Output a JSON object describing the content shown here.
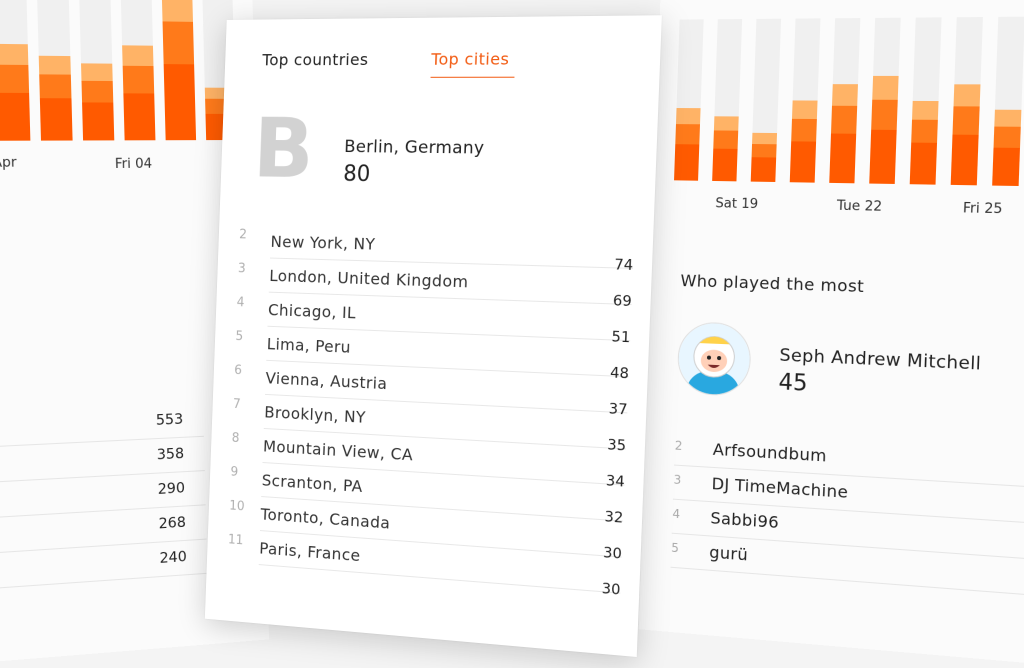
{
  "colors": {
    "accent": "#f25b12",
    "bar_track": "#f0f0f0",
    "bar_dark": "#ff5a00",
    "bar_mid": "#ff7a1a",
    "bar_light": "#ffb366"
  },
  "left_chart": {
    "labels": [
      "Apr",
      "Fri 04"
    ],
    "bars": [
      0.55,
      0.62,
      0.55,
      0.5,
      0.62,
      1.0,
      0.35
    ]
  },
  "left_values": [
    "553",
    "358",
    "290",
    "268",
    "240"
  ],
  "tabs": {
    "countries": "Top countries",
    "cities": "Top cities"
  },
  "top_city": {
    "letter": "B",
    "name": "Berlin, Germany",
    "count": "80"
  },
  "cities": [
    {
      "rank": "2",
      "name": "New York, NY",
      "value": "74"
    },
    {
      "rank": "3",
      "name": "London, United Kingdom",
      "value": "69"
    },
    {
      "rank": "4",
      "name": "Chicago, IL",
      "value": "51"
    },
    {
      "rank": "5",
      "name": "Lima, Peru",
      "value": "48"
    },
    {
      "rank": "6",
      "name": "Vienna, Austria",
      "value": "37"
    },
    {
      "rank": "7",
      "name": "Brooklyn, NY",
      "value": "35"
    },
    {
      "rank": "8",
      "name": "Mountain View, CA",
      "value": "34"
    },
    {
      "rank": "9",
      "name": "Scranton, PA",
      "value": "32"
    },
    {
      "rank": "10",
      "name": "Toronto, Canada",
      "value": "30"
    },
    {
      "rank": "11",
      "name": "Paris, France",
      "value": "30"
    }
  ],
  "right_chart": {
    "labels": [
      "Sat 19",
      "Tue 22",
      "Fri 25"
    ],
    "bars": [
      0.45,
      0.4,
      0.3,
      0.5,
      0.6,
      0.65,
      0.5,
      0.6,
      0.45,
      0.4
    ]
  },
  "who_played": {
    "title": "Who played the most",
    "top": {
      "name": "Seph Andrew Mitchell",
      "count": "45"
    },
    "list": [
      {
        "rank": "2",
        "name": "Arfsoundbum"
      },
      {
        "rank": "3",
        "name": "DJ TimeMachine"
      },
      {
        "rank": "4",
        "name": "Sabbi96"
      },
      {
        "rank": "5",
        "name": "gurü"
      }
    ]
  }
}
